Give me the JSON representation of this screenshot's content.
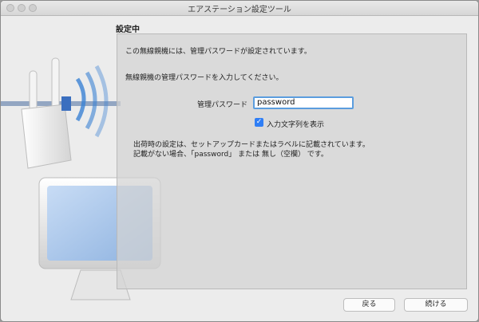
{
  "window": {
    "title": "エアステーション設定ツール"
  },
  "step_title": "設定中",
  "panel": {
    "intro": "この無線親機には、管理パスワードが設定されています。",
    "instruction": "無線親機の管理パスワードを入力してください。",
    "password_label": "管理パスワード",
    "password_value": "password",
    "show_chars_label": "入力文字列を表示",
    "show_chars_checked": true,
    "note_line1": "出荷時の設定は、セットアップカードまたはラベルに記載されています。",
    "note_line2": "記載がない場合、「password」 または 無し（空欄） です。"
  },
  "buttons": {
    "back": "戻る",
    "next": "続ける"
  },
  "colors": {
    "accent": "#2f7ef5",
    "focus_ring": "#5b9dde"
  }
}
